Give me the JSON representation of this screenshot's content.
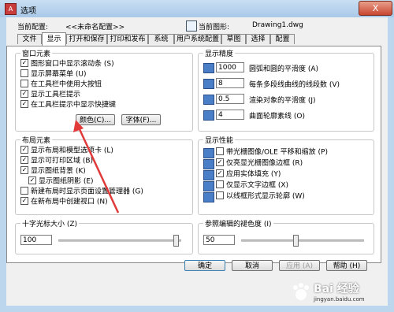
{
  "window": {
    "title": "选项",
    "close_glyph": "X"
  },
  "header": {
    "profile_label": "当前配置:",
    "profile_value": "<<未命名配置>>",
    "drawing_label": "当前图形:",
    "drawing_value": "Drawing1.dwg"
  },
  "tabs": [
    "文件",
    "显示",
    "打开和保存",
    "打印和发布",
    "系统",
    "用户系统配置",
    "草图",
    "选择",
    "配置"
  ],
  "active_tab": "显示",
  "window_elements": {
    "title": "窗口元素",
    "options": [
      {
        "label": "图形窗口中显示滚动条 (S)",
        "checked": true
      },
      {
        "label": "显示屏幕菜单 (U)",
        "checked": false
      },
      {
        "label": "在工具栏中使用大按钮",
        "checked": false
      },
      {
        "label": "显示工具栏提示",
        "checked": true
      },
      {
        "label": "在工具栏提示中显示快捷键",
        "checked": true
      }
    ],
    "color_button": "颜色(C)...",
    "font_button": "字体(F)..."
  },
  "layout_elements": {
    "title": "布局元素",
    "options": [
      {
        "label": "显示布局和模型选项卡 (L)",
        "checked": true
      },
      {
        "label": "显示可打印区域 (B)",
        "checked": true
      },
      {
        "label": "显示图纸背景 (K)",
        "checked": true
      },
      {
        "label": "显示图纸阴影 (E)",
        "checked": true
      },
      {
        "label": "新建布局时显示页面设置管理器 (G)",
        "checked": false
      },
      {
        "label": "在新布局中创建视口 (N)",
        "checked": true
      }
    ]
  },
  "crosshair": {
    "label": "十字光标大小 (Z)",
    "value": "100",
    "level": 100
  },
  "display_resolution": {
    "title": "显示精度",
    "rows": [
      {
        "value": "1000",
        "label": "圆弧和圆的平滑度 (A)"
      },
      {
        "value": "8",
        "label": "每条多段线曲线的线段数 (V)"
      },
      {
        "value": "0.5",
        "label": "渲染对象的平滑度 (J)"
      },
      {
        "value": "4",
        "label": "曲面轮廓素线 (O)"
      }
    ]
  },
  "display_performance": {
    "title": "显示性能",
    "options": [
      {
        "label": "带光栅图像/OLE 平移和缩放 (P)",
        "checked": false
      },
      {
        "label": "仅亮显光栅图像边框 (R)",
        "checked": true
      },
      {
        "label": "应用实体填充 (Y)",
        "checked": true
      },
      {
        "label": "仅显示文字边框 (X)",
        "checked": false
      },
      {
        "label": "以线框形式显示轮廓 (W)",
        "checked": false
      }
    ]
  },
  "xref_fade": {
    "label": "参照编辑的褪色度 (I)",
    "value": "50",
    "level": 50
  },
  "buttons": {
    "ok": "确定",
    "cancel": "取消",
    "apply": "应用 (A)",
    "help": "帮助 (H)"
  },
  "watermark": {
    "text": "Bai 经验",
    "url": "jingyan.baidu.com"
  },
  "colors": {
    "arrow": "#e03a3a",
    "title_bg": "#bcd6ee",
    "icon_blue": "#4a7fc8"
  }
}
